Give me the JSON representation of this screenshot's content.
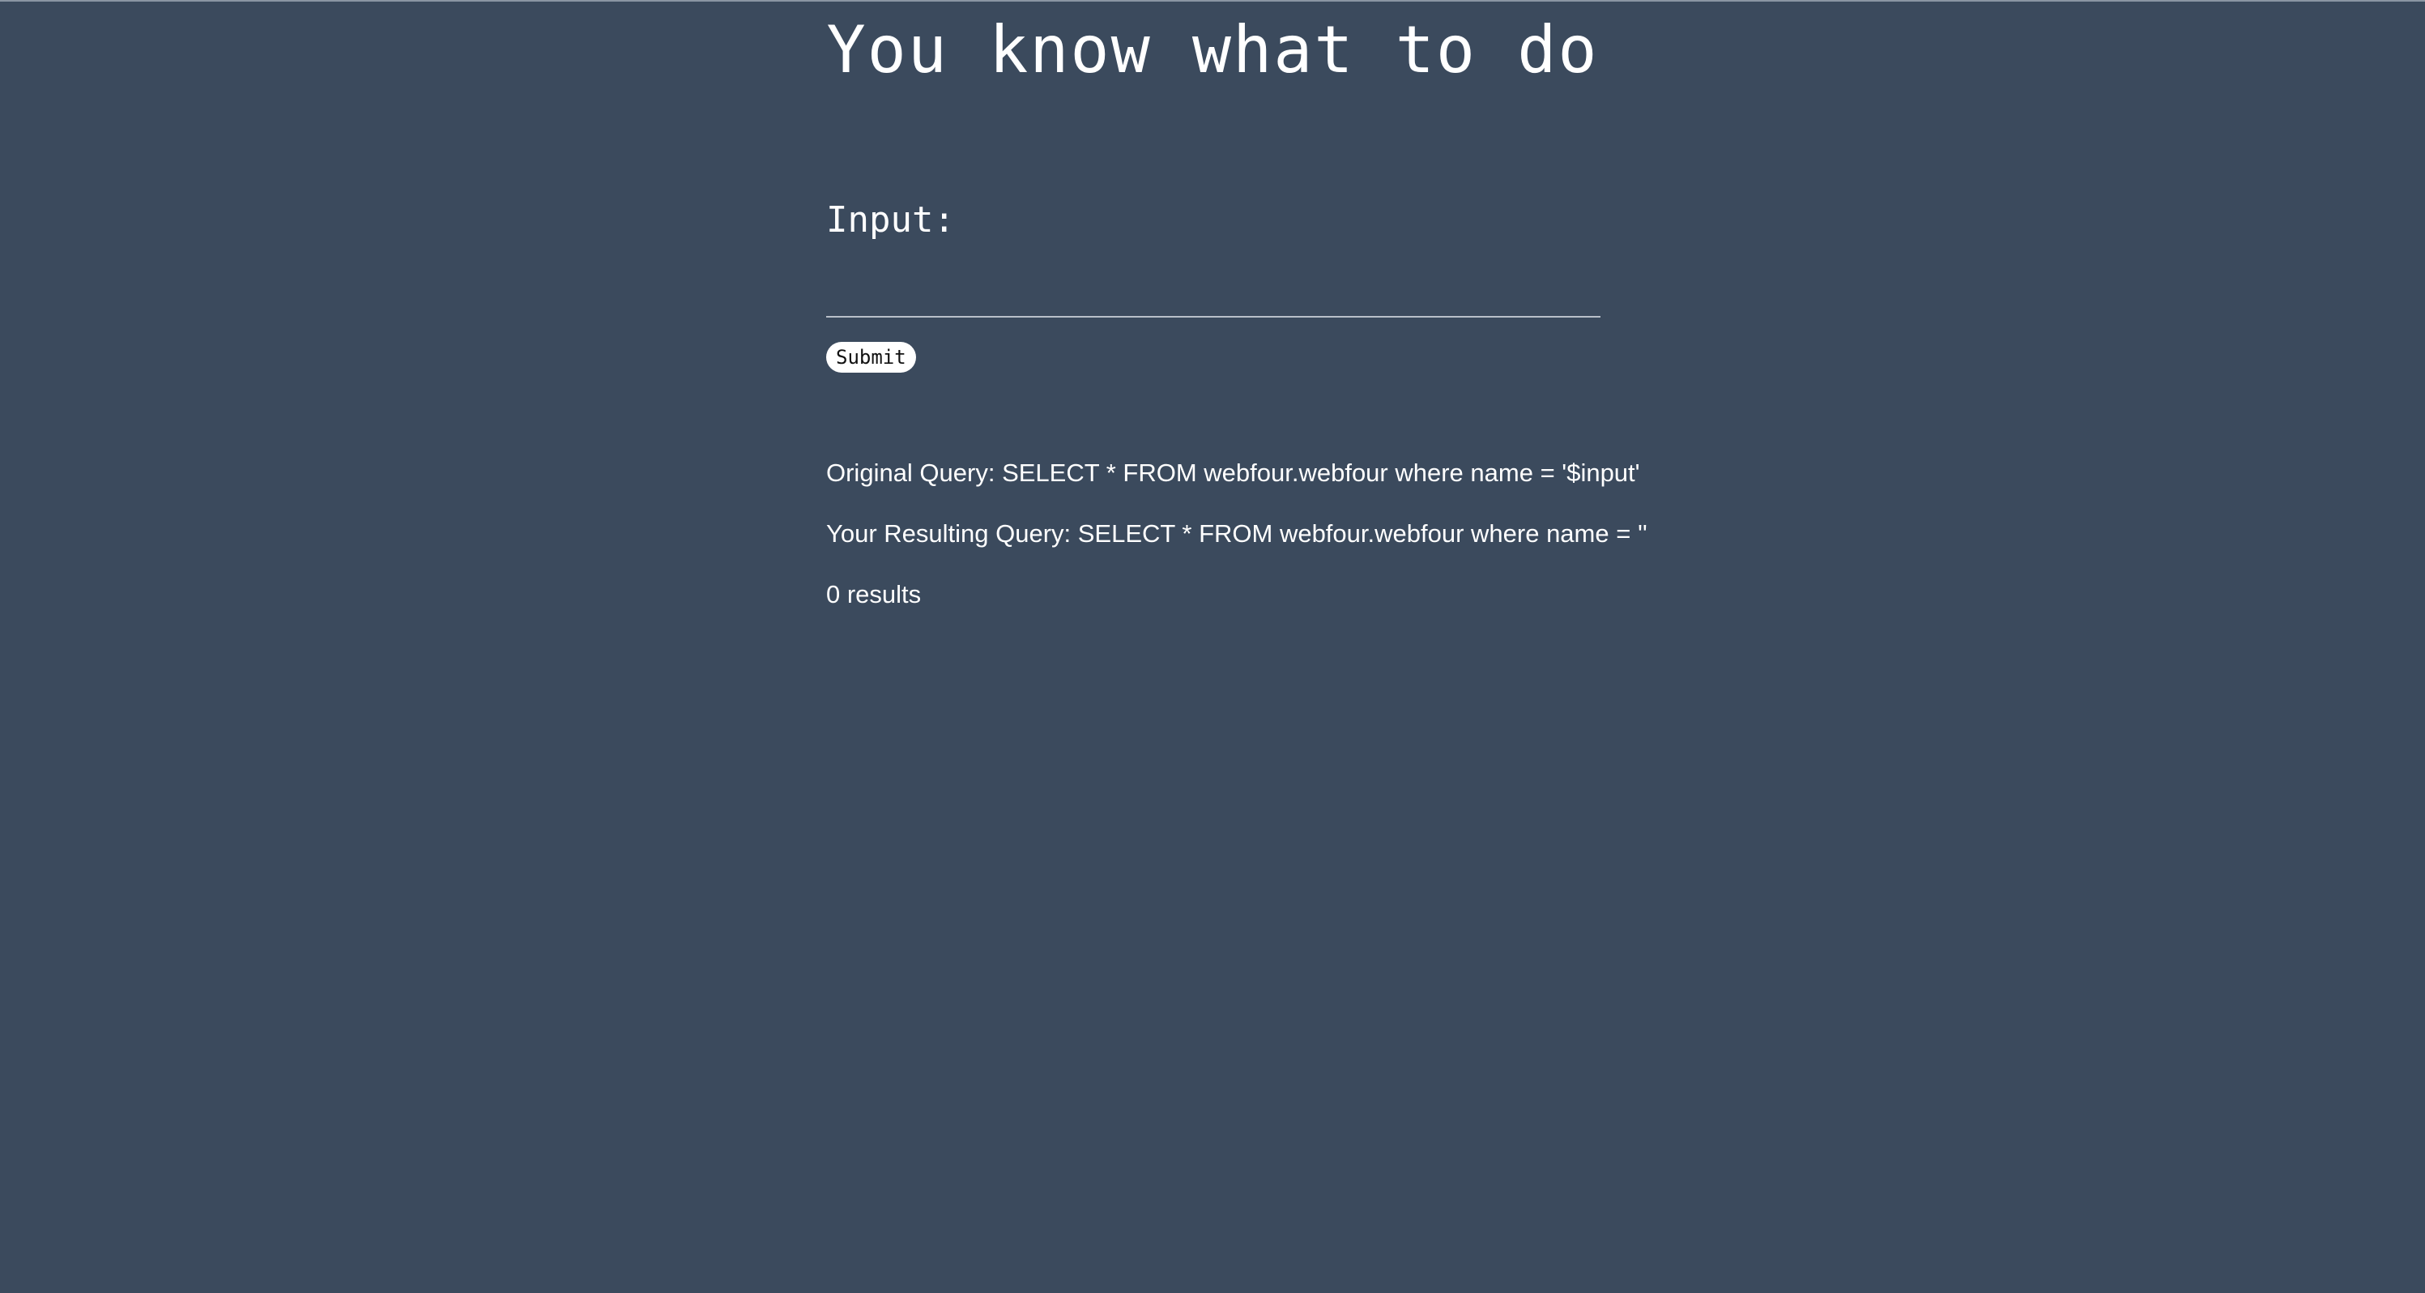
{
  "page": {
    "title": "You know what to do"
  },
  "form": {
    "input_label": "Input:",
    "input_value": "",
    "input_placeholder": "",
    "submit_label": "Submit"
  },
  "results": {
    "original_query": "Original Query: SELECT * FROM webfour.webfour where name = '$input'",
    "resulting_query": "Your Resulting Query: SELECT * FROM webfour.webfour where name = ''",
    "count_text": "0 results"
  },
  "colors": {
    "background": "#3b4a5d",
    "text": "#ffffff",
    "input_underline": "#b9c0c9",
    "button_background": "#ffffff"
  }
}
